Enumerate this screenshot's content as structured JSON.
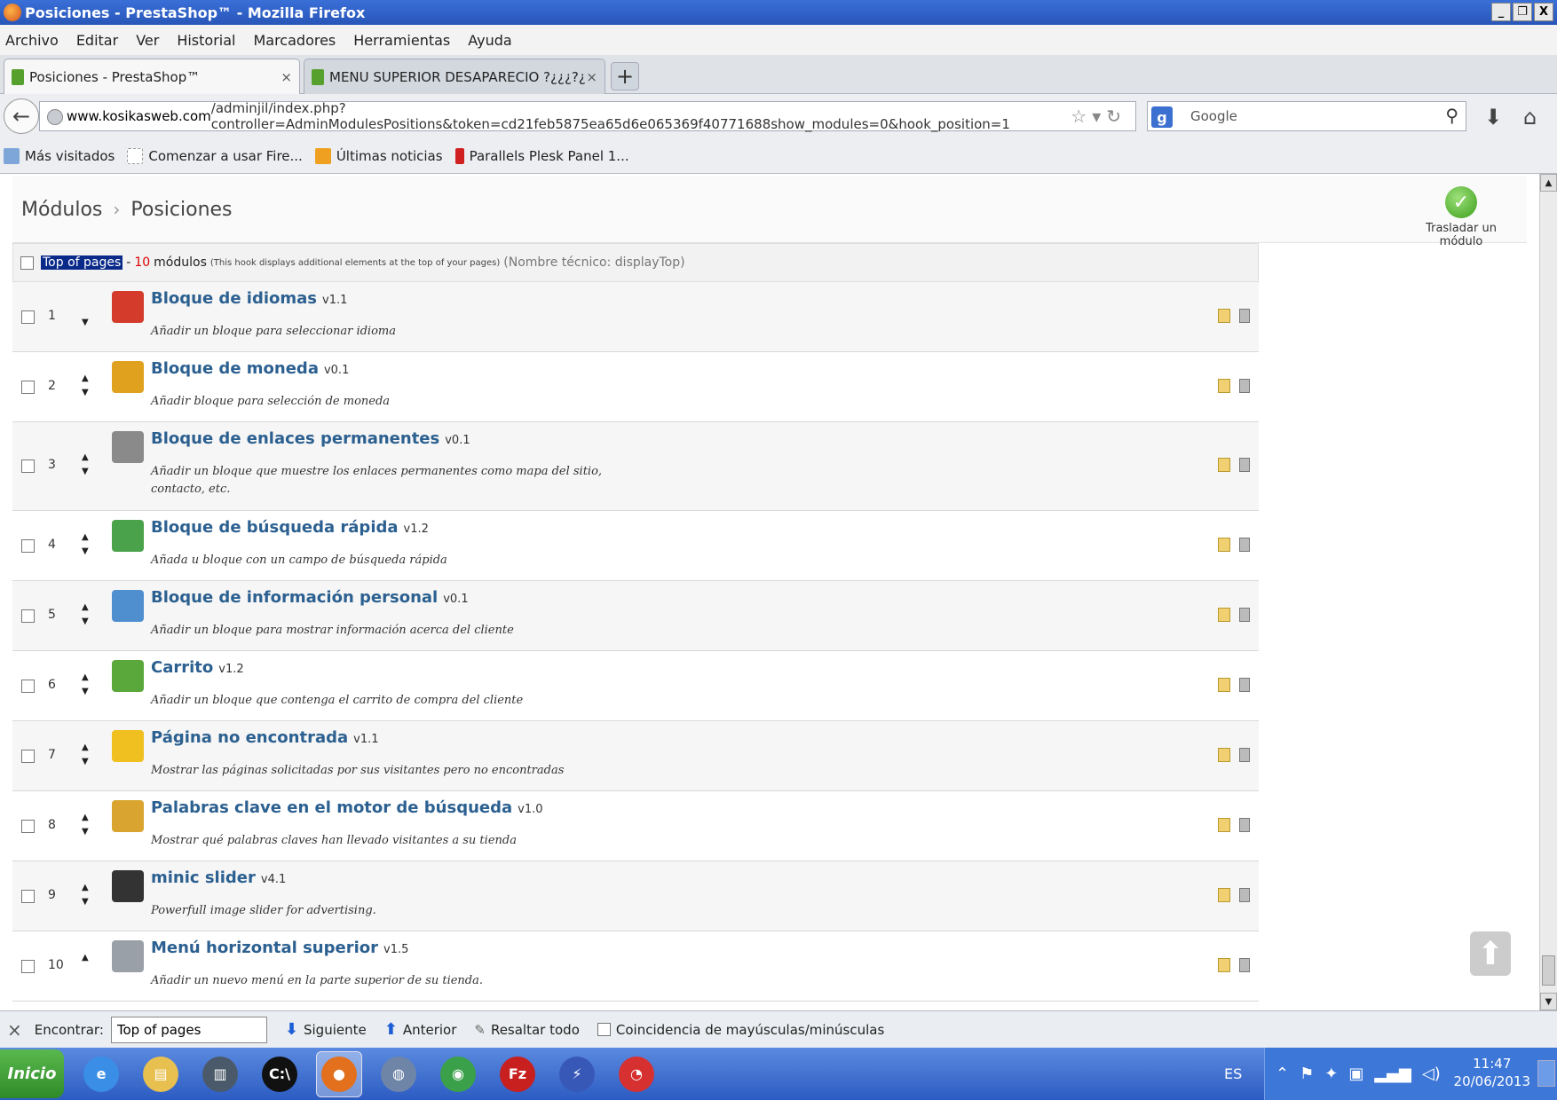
{
  "window": {
    "title": "Posiciones - PrestaShop™ - Mozilla Firefox",
    "controls": [
      "_",
      "❐",
      "X"
    ]
  },
  "menu": [
    "Archivo",
    "Editar",
    "Ver",
    "Historial",
    "Marcadores",
    "Herramientas",
    "Ayuda"
  ],
  "tabs": [
    {
      "label": "Posiciones - PrestaShop™",
      "close": "×"
    },
    {
      "label": "MENU SUPERIOR DESAPARECIO ?¿¿¿?¿...",
      "close": "×"
    }
  ],
  "new_tab": "+",
  "url": {
    "host": "www.kosikasweb.com",
    "path": "/adminjil/index.php?controller=AdminModulesPositions&token=cd21feb5875ea65d6e065369f40771688show_modules=0&hook_position=1"
  },
  "search": {
    "engine_glyph": "g",
    "placeholder": "Google"
  },
  "bookmarks": [
    "Más visitados",
    "Comenzar a usar Fire...",
    "Últimas noticias",
    "Parallels Plesk Panel 1..."
  ],
  "breadcrumb": {
    "parent": "Módulos",
    "current": "Posiciones"
  },
  "move_module_label": "Trasladar un módulo",
  "hook": {
    "name": "Top of pages",
    "count": "10",
    "count_label": "módulos",
    "description": "(This hook displays additional elements at the top of your pages)",
    "technical": "(Nombre técnico: displayTop)"
  },
  "modules": [
    {
      "pos": "1",
      "title": "Bloque de idiomas",
      "version": "v1.1",
      "desc": "Añadir un bloque para seleccionar idioma",
      "icon": "flags-icon",
      "color": "#d43b2b"
    },
    {
      "pos": "2",
      "title": "Bloque de moneda",
      "version": "v0.1",
      "desc": "Añadir bloque para selección de moneda",
      "icon": "currency-icon",
      "color": "#e0a21e"
    },
    {
      "pos": "3",
      "title": "Bloque de enlaces permanentes",
      "version": "v0.1",
      "desc": "Añadir un bloque que muestre los enlaces permanentes como mapa del sitio, contacto, etc.",
      "icon": "link-icon",
      "color": "#8a8a8a"
    },
    {
      "pos": "4",
      "title": "Bloque de búsqueda rápida",
      "version": "v1.2",
      "desc": "Añada u bloque con un campo de búsqueda rápida",
      "icon": "search-icon",
      "color": "#4aa34a"
    },
    {
      "pos": "5",
      "title": "Bloque de información personal",
      "version": "v0.1",
      "desc": "Añadir un bloque para mostrar información acerca del cliente",
      "icon": "user-card-icon",
      "color": "#4f8fd0"
    },
    {
      "pos": "6",
      "title": "Carrito",
      "version": "v1.2",
      "desc": "Añadir un bloque que contenga el carrito de compra del cliente",
      "icon": "cart-icon",
      "color": "#5aa83c"
    },
    {
      "pos": "7",
      "title": "Página no encontrada",
      "version": "v1.1",
      "desc": "Mostrar las páginas solicitadas por sus visitantes pero no encontradas",
      "icon": "warning-icon",
      "color": "#f0c020"
    },
    {
      "pos": "8",
      "title": "Palabras clave en el motor de búsqueda",
      "version": "v1.0",
      "desc": "Mostrar qué palabras claves han llevado visitantes a su tienda",
      "icon": "key-icon",
      "color": "#d9a530"
    },
    {
      "pos": "9",
      "title": "minic slider",
      "version": "v4.1",
      "desc": "Powerfull image slider for advertising.",
      "icon": "slider-icon",
      "color": "#333333"
    },
    {
      "pos": "10",
      "title": "Menú horizontal superior",
      "version": "v1.5",
      "desc": "Añadir un nuevo menú en la parte superior de su tienda.",
      "icon": "menu-icon",
      "color": "#9aa0a8"
    }
  ],
  "find": {
    "close": "×",
    "label": "Encontrar:",
    "value": "Top of pages",
    "next": "Siguiente",
    "prev": "Anterior",
    "highlight": "Resaltar todo",
    "match_case": "Coincidencia de mayúsculas/minúsculas"
  },
  "taskbar": {
    "start": "Inicio",
    "apps": [
      {
        "icon": "ie-icon",
        "color": "#3a8ee6",
        "glyph": "e"
      },
      {
        "icon": "folder-icon",
        "color": "#e8c050",
        "glyph": "▤"
      },
      {
        "icon": "network-icon",
        "color": "#4b5a6a",
        "glyph": "▥"
      },
      {
        "icon": "cmd-icon",
        "color": "#111111",
        "glyph": "C:\\"
      },
      {
        "icon": "firefox-icon",
        "color": "#e2701d",
        "glyph": "●",
        "active": true
      },
      {
        "icon": "messenger-icon",
        "color": "#6f85a8",
        "glyph": "◍"
      },
      {
        "icon": "chrome-icon",
        "color": "#3aa14a",
        "glyph": "◉"
      },
      {
        "icon": "filezilla-icon",
        "color": "#c81f1f",
        "glyph": "Fz"
      },
      {
        "icon": "remote-icon",
        "color": "#3858b8",
        "glyph": "⚡"
      },
      {
        "icon": "app-icon",
        "color": "#d63030",
        "glyph": "◔"
      }
    ],
    "lang": "ES",
    "time": "11:47",
    "date": "20/06/2013"
  }
}
